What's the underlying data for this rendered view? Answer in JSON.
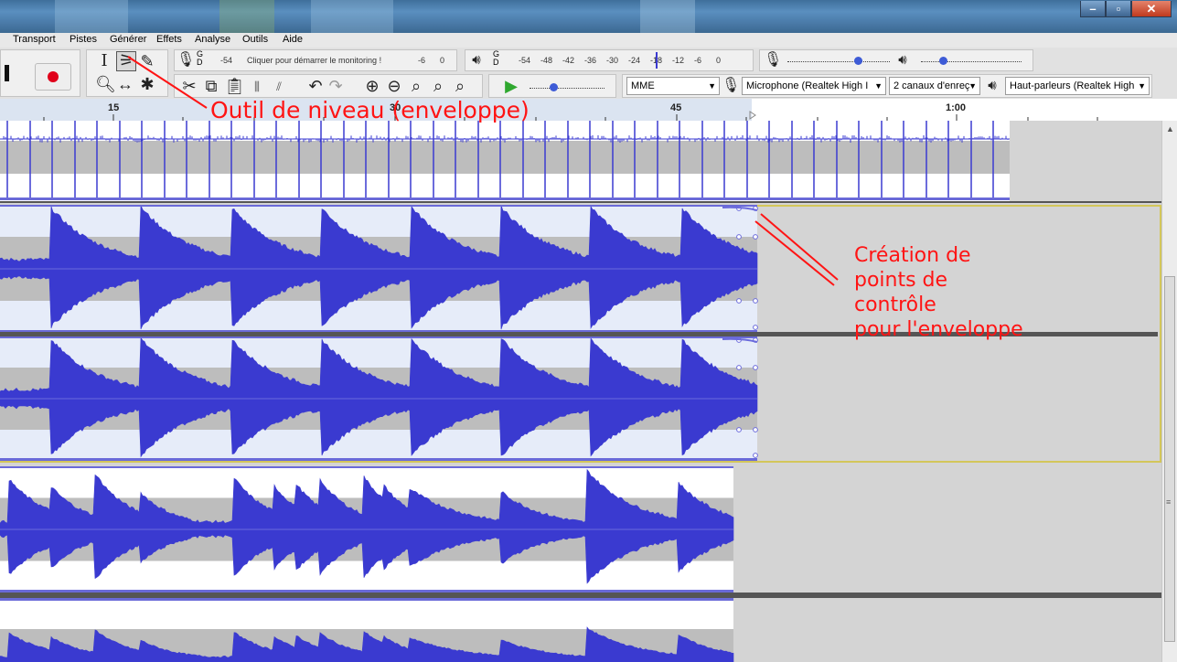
{
  "menu": [
    "Transport",
    "Pistes",
    "Générer",
    "Effets",
    "Analyse",
    "Outils",
    "Aide"
  ],
  "meters": {
    "record_channels": "G\nD",
    "record_prompt": "Cliquer pour démarrer le monitoring !",
    "record_ticks": [
      "-54",
      "-6",
      "0"
    ],
    "play_channels": "G\nD",
    "play_ticks": [
      "-54",
      "-48",
      "-42",
      "-36",
      "-30",
      "-24",
      "-18",
      "-12",
      "-6",
      "0"
    ]
  },
  "devices": {
    "host": "MME",
    "input": "Microphone (Realtek High I",
    "channels": "2 canaux d'enreç",
    "output": "Haut-parleurs (Realtek High"
  },
  "ruler": {
    "labels": [
      "15",
      "30",
      "45",
      "1:00"
    ]
  },
  "annotations": {
    "tool_label": "Outil de niveau (enveloppe)",
    "control_points_label": [
      "Création de",
      "points de",
      "contrôle",
      "pour l'enveloppe"
    ],
    "color": "#ff1414"
  },
  "colors": {
    "waveform": "#3a3ad0",
    "waveform_rms": "#6b6bdc",
    "track_bg": "#ffffff",
    "clip_bg_sel": "#e6ecf9",
    "grey_band": "#bdbdbd",
    "selection_border": "#d3c65a"
  },
  "icons": {
    "selection": "i-beam-icon",
    "envelope": "envelope-tool-icon",
    "draw": "pencil-icon",
    "record": "record-icon",
    "pause": "pause-icon",
    "zoom": "zoom-tool-icon",
    "timeshift": "time-shift-icon",
    "multi": "multi-tool-icon",
    "cut": "scissors-icon",
    "copy": "copy-icon",
    "paste": "paste-icon",
    "trim": "trim-icon",
    "silence": "silence-icon",
    "undo": "undo-icon",
    "redo": "redo-icon",
    "zoom_in": "zoom-in-icon",
    "zoom_out": "zoom-out-icon",
    "fit_sel": "fit-selection-icon",
    "fit_proj": "fit-project-icon",
    "zoom_toggle": "zoom-toggle-icon",
    "play_at_speed": "play-at-speed-icon",
    "mic": "microphone-icon",
    "speaker": "speaker-icon"
  }
}
